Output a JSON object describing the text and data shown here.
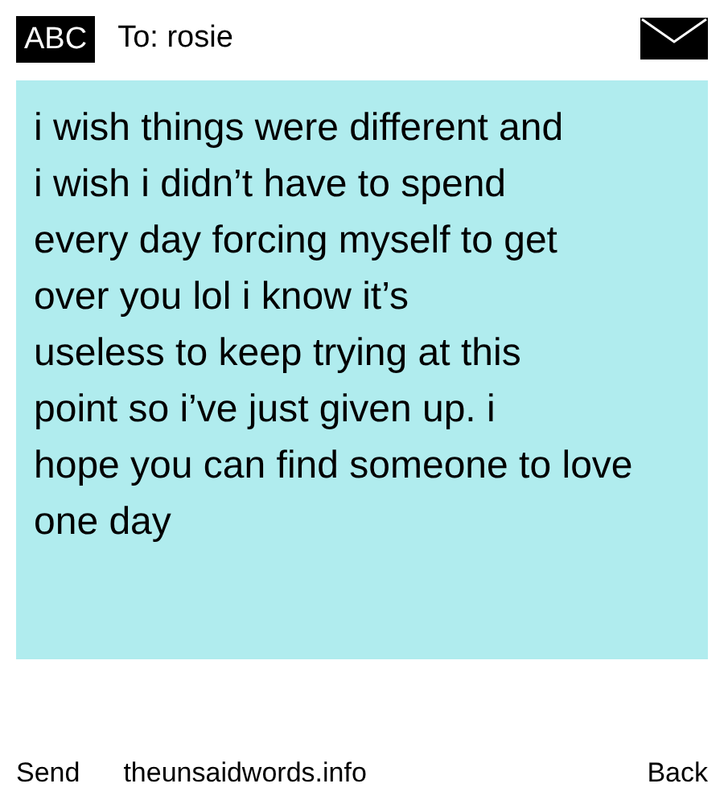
{
  "header": {
    "mode_badge": "ABC",
    "recipient": "To: rosie"
  },
  "message": {
    "value": "i wish things were different and\ni wish i didn’t have to spend\nevery day forcing myself to get\nover you lol i know it’s\nuseless to keep trying at this\npoint so i’ve just given up. i\nhope you can find someone to love\none day"
  },
  "footer": {
    "send": "Send",
    "site": "theunsaidwords.info",
    "back": "Back"
  }
}
